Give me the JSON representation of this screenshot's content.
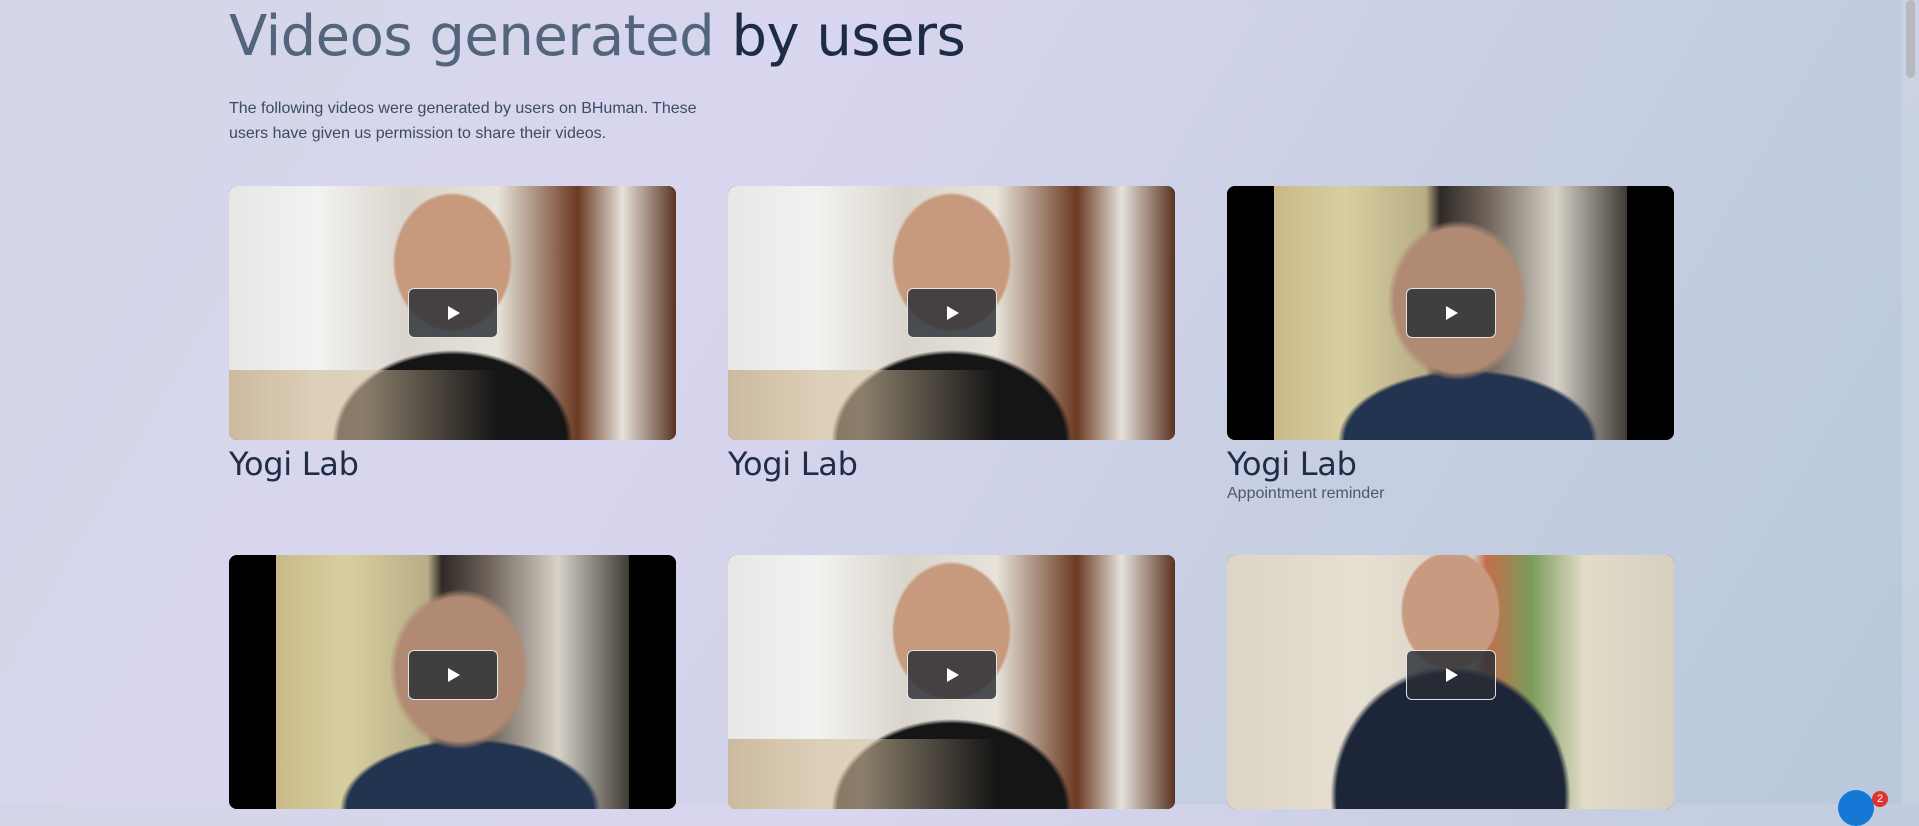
{
  "header": {
    "title_muted": "Videos generated",
    "title_strong": "by users",
    "description": "The following videos were generated by users on BHuman. These users have given us permission to share their videos."
  },
  "videos": [
    {
      "name": "Yogi Lab",
      "subtitle": "",
      "scene": "bedroom"
    },
    {
      "name": "Yogi Lab",
      "subtitle": "",
      "scene": "bedroom"
    },
    {
      "name": "Yogi Lab",
      "subtitle": "Appointment reminder",
      "scene": "stone"
    },
    {
      "name": "",
      "subtitle": "",
      "scene": "stone"
    },
    {
      "name": "",
      "subtitle": "",
      "scene": "bedroom"
    },
    {
      "name": "",
      "subtitle": "",
      "scene": "studio"
    }
  ],
  "chat_widget": {
    "badge_count": "2",
    "icon": "chat-icon"
  },
  "icons": {
    "play": "play-icon"
  }
}
